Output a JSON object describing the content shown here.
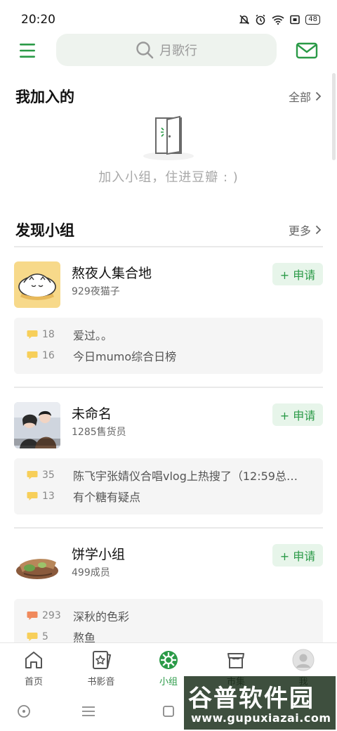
{
  "status_bar": {
    "time": "20:20",
    "battery": "48"
  },
  "search": {
    "placeholder": "月歌行"
  },
  "my_groups": {
    "title": "我加入的",
    "all_label": "全部",
    "empty_text": "加入小组，住进豆瓣 : )"
  },
  "discover": {
    "title": "发现小组",
    "more_label": "更多",
    "join_label": "+ 申请",
    "groups": [
      {
        "name": "熬夜人集合地",
        "members": "929夜猫子",
        "topics": [
          {
            "count": "18",
            "title": "爱过。。",
            "hot": false
          },
          {
            "count": "16",
            "title": "今日mumo综合日榜",
            "hot": false
          }
        ]
      },
      {
        "name": "未命名",
        "members": "1285售货员",
        "topics": [
          {
            "count": "35",
            "title": "陈飞宇张婧仪合唱vlog上热搜了（12:59总…",
            "hot": false
          },
          {
            "count": "13",
            "title": "有个糖有疑点",
            "hot": false
          }
        ]
      },
      {
        "name": "饼学小组",
        "members": "499成员",
        "topics": [
          {
            "count": "293",
            "title": "深秋的色彩",
            "hot": true
          },
          {
            "count": "5",
            "title": "熬鱼",
            "hot": false
          }
        ]
      }
    ]
  },
  "tabbar": {
    "tabs": [
      {
        "label": "首页",
        "icon": "home-icon"
      },
      {
        "label": "书影音",
        "icon": "media-card-icon"
      },
      {
        "label": "小组",
        "icon": "group-icon",
        "active": true
      },
      {
        "label": "市集",
        "icon": "market-icon"
      },
      {
        "label": "我",
        "icon": "profile-avatar-icon"
      }
    ]
  },
  "watermark": {
    "title": "谷普软件园",
    "url": "www.gupuxiazai.com"
  },
  "colors": {
    "accent": "#2a9a47",
    "search_bg": "#eef3ee",
    "join_bg": "#e7f5ea",
    "topic_bg": "#f5f5f5",
    "comment_yellow": "#f7cf5a",
    "comment_hot": "#f08a5d"
  }
}
